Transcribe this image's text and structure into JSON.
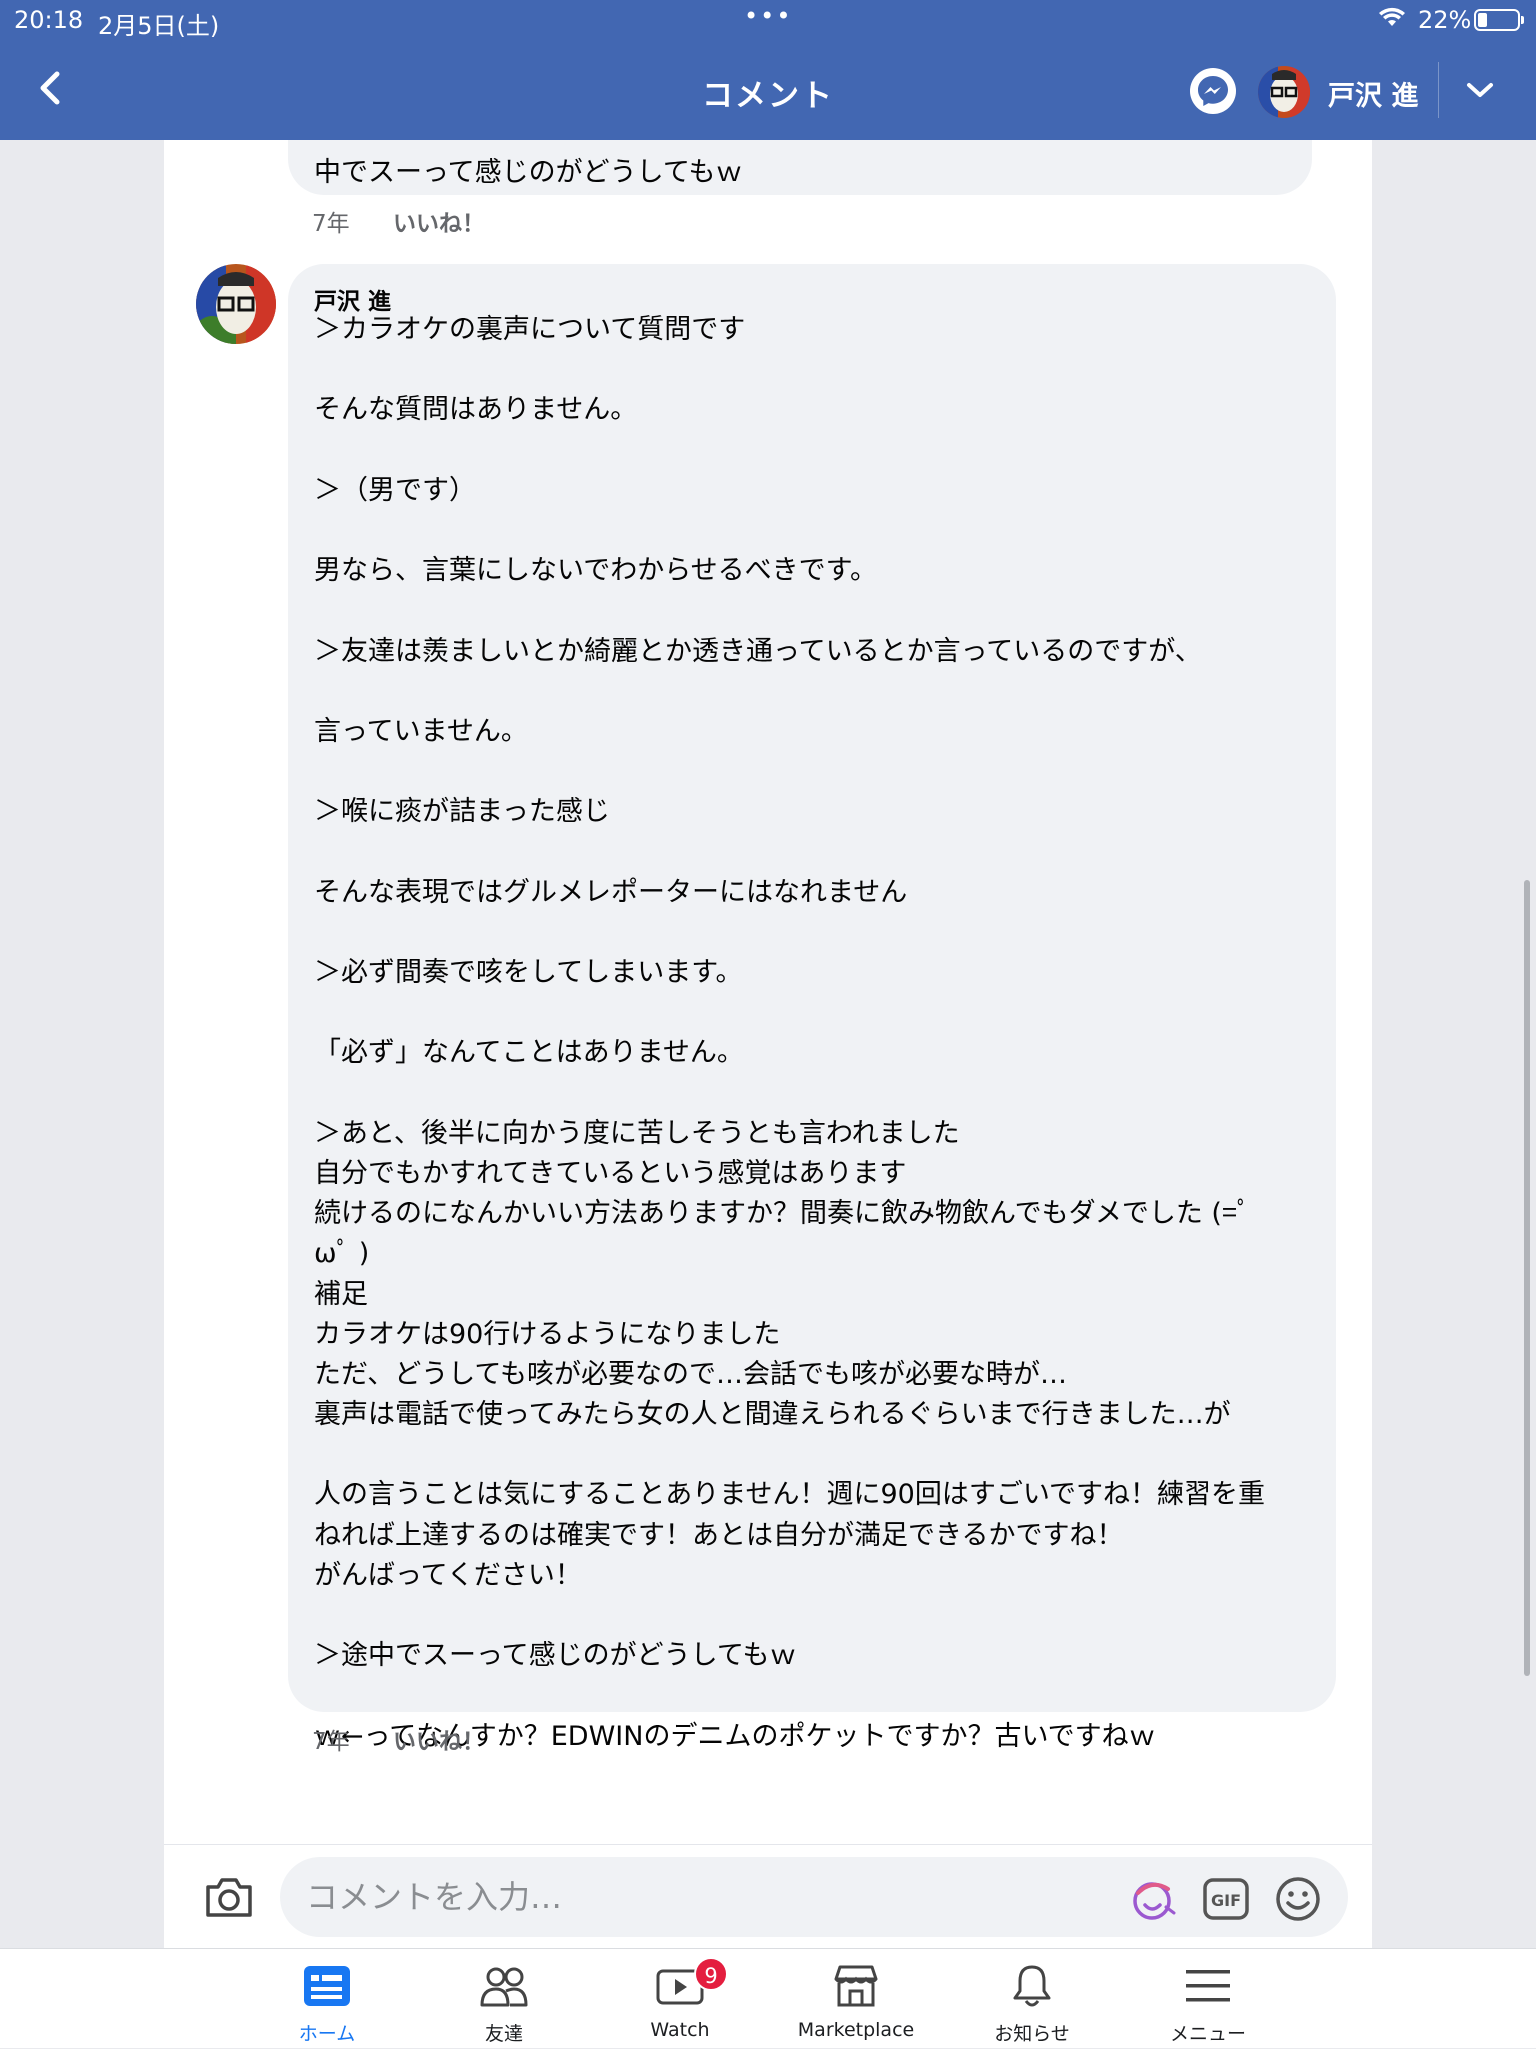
{
  "status_bar": {
    "time": "20:18",
    "date": "2月5日(土)",
    "battery": "22%"
  },
  "header": {
    "title": "コメント",
    "user_name": "戸沢 進"
  },
  "previous_comment": {
    "text_tail": "中でスーって感じのがどうしてもｗ",
    "age": "7年",
    "like": "いいね！"
  },
  "comment": {
    "author": "戸沢 進",
    "lines": [
      "＞カラオケの裏声について質問です",
      "",
      "そんな質問はありません。",
      "",
      "＞（男です）",
      "",
      "男なら、言葉にしないでわからせるべきです。",
      "",
      "＞友達は羨ましいとか綺麗とか透き通っているとか言っているのですが、",
      "",
      "言っていません。",
      "",
      "＞喉に痰が詰まった感じ",
      "",
      "そんな表現ではグルメレポーターにはなれません",
      "",
      "＞必ず間奏で咳をしてしまいます。",
      "",
      "「必ず」なんてことはありません。",
      "",
      "＞あと、後半に向かう度に苦しそうとも言われました",
      "自分でもかすれてきているという感覚はあります",
      "続けるのになんかいい方法ありますか？間奏に飲み物飲んでもダメでした (=ﾟ",
      "ωﾟ )",
      "補足",
      "カラオケは90行けるようになりました",
      "ただ、どうしても咳が必要なので…会話でも咳が必要な時が…",
      "裏声は電話で使ってみたら女の人と間違えられるぐらいまで行きました…が",
      "",
      "人の言うことは気にすることありません！週に90回はすごいですね！練習を重",
      "ねれば上達するのは確実です！あとは自分が満足できるかですね！",
      "がんばってください！",
      "",
      "＞途中でスーって感じのがどうしてもｗ",
      "",
      "ｗ←ってなんすか？EDWINのデニムのポケットですか？古いですねｗ"
    ],
    "age": "7年",
    "like": "いいね！"
  },
  "composer": {
    "placeholder": "コメントを入力…"
  },
  "tabs": [
    {
      "label": "ホーム",
      "icon": "home-icon",
      "active": true
    },
    {
      "label": "友達",
      "icon": "friends-icon"
    },
    {
      "label": "Watch",
      "icon": "watch-icon",
      "badge": "9"
    },
    {
      "label": "Marketplace",
      "icon": "marketplace-icon"
    },
    {
      "label": "お知らせ",
      "icon": "bell-icon"
    },
    {
      "label": "メニュー",
      "icon": "menu-icon"
    }
  ],
  "colors": {
    "header_bg": "#4267b2",
    "accent": "#1877f2",
    "bubble_bg": "#f0f2f5",
    "badge": "#e41e3f"
  }
}
